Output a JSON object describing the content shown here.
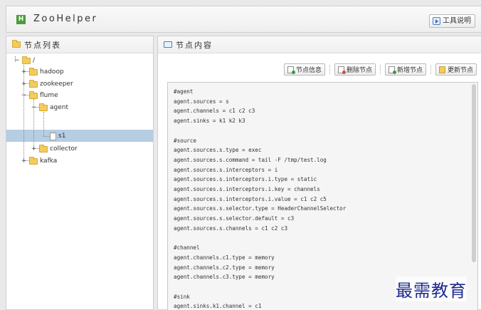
{
  "header": {
    "title": "ZooHelper",
    "logo_letter": "H",
    "tool_button": "工具说明"
  },
  "left_panel": {
    "title": "节点列表",
    "tree": {
      "root": "/",
      "hadoop": "hadoop",
      "zookeeper": "zookeeper",
      "flume": "flume",
      "agent": "agent",
      "s1": "s1",
      "collector": "collector",
      "kafka": "kafka",
      "selected": "s1"
    }
  },
  "right_panel": {
    "title": "节点内容",
    "buttons": {
      "info": "节点信息",
      "delete": "删除节点",
      "add": "新增节点",
      "update": "更新节点"
    },
    "content_lines": [
      "#agent",
      "agent.sources = s",
      "agent.channels = c1 c2 c3",
      "agent.sinks = k1 k2 k3",
      "",
      "#source",
      "agent.sources.s.type = exec",
      "agent.sources.s.command = tail -F /tmp/test.log",
      "agent.sources.s.interceptors = i",
      "agent.sources.s.interceptors.i.type = static",
      "agent.sources.s.interceptors.i.key = channels",
      "agent.sources.s.interceptors.i.value = c1 c2 c5",
      "agent.sources.s.selector.type = HeaderChannelSelector",
      "agent.sources.s.selector.default = c3",
      "agent.sources.s.channels = c1 c2 c3",
      "",
      "#channel",
      "agent.channels.c1.type = memory",
      "agent.channels.c2.type = memory",
      "agent.channels.c3.type = memory",
      "",
      "#sink",
      "agent.sinks.k1.channel = c1"
    ]
  },
  "watermark": "最需教育",
  "colors": {
    "selected_row": "#b6cde3",
    "folder": "#f3cd5c",
    "watermark": "#1e2b8f"
  }
}
